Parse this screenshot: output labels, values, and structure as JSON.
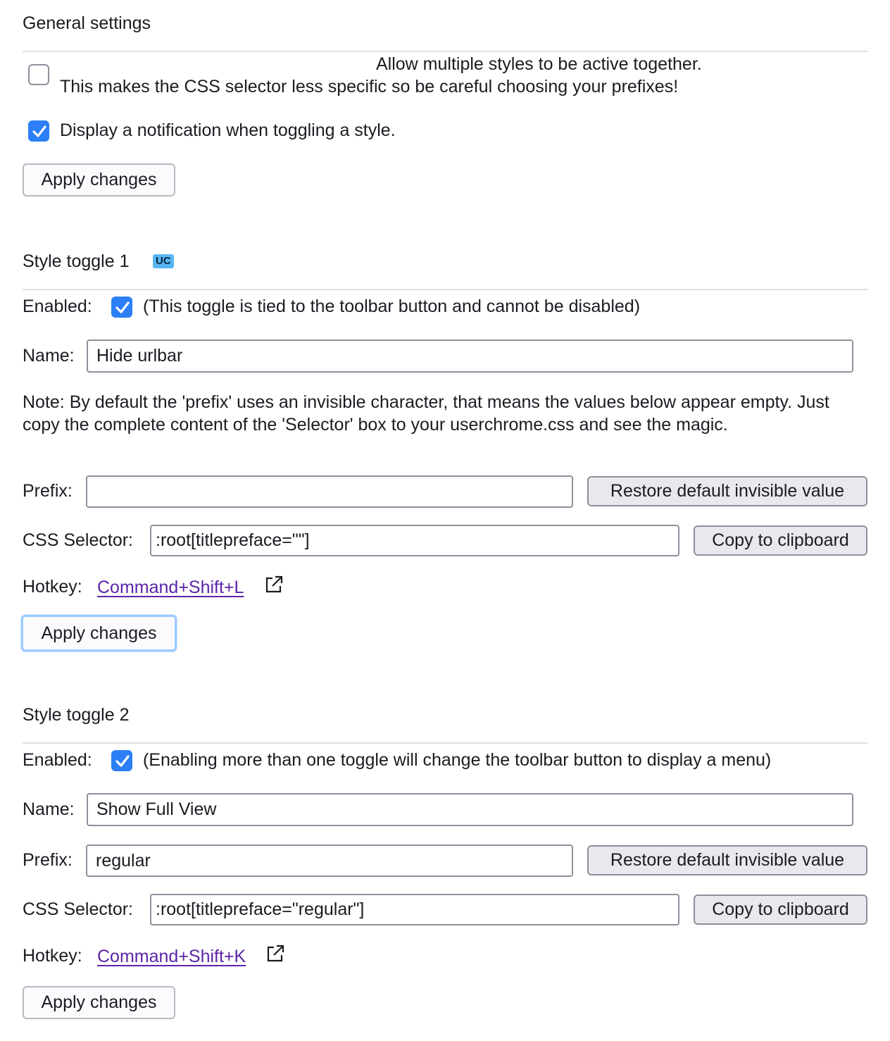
{
  "general": {
    "title": "General settings",
    "multi_styles_line1": "Allow multiple styles to be active together.",
    "multi_styles_line2": "This makes the CSS selector less specific so be careful choosing your prefixes!",
    "multi_styles_checked": false,
    "notification_label": "Display a notification when toggling a style.",
    "notification_checked": true,
    "apply_label": "Apply changes"
  },
  "toggles": [
    {
      "title": "Style toggle 1",
      "badge": "UC",
      "enabled_label": "Enabled:",
      "enabled_checked": true,
      "enabled_note": "(This toggle is tied to the toolbar button and cannot be disabled)",
      "name_label": "Name:",
      "name_value": "Hide urlbar",
      "note": "Note: By default the 'prefix' uses an invisible character, that means the values below appear empty. Just copy the complete content of the 'Selector' box to your userchrome.css and see the magic.",
      "prefix_label": "Prefix:",
      "prefix_value": "",
      "restore_label": "Restore default invisible value",
      "selector_label": "CSS Selector:",
      "selector_value": ":root[titlepreface=\"\"]",
      "copy_label": "Copy to clipboard",
      "hotkey_label": "Hotkey:",
      "hotkey_value": "Command+Shift+L",
      "apply_label": "Apply changes"
    },
    {
      "title": "Style toggle 2",
      "enabled_label": "Enabled:",
      "enabled_checked": true,
      "enabled_note": "(Enabling more than one toggle will change the toolbar button to display a menu)",
      "name_label": "Name:",
      "name_value": "Show Full View",
      "prefix_label": "Prefix:",
      "prefix_value": "regular",
      "restore_label": "Restore default invisible value",
      "selector_label": "CSS Selector:",
      "selector_value": ":root[titlepreface=\"regular\"]",
      "copy_label": "Copy to clipboard",
      "hotkey_label": "Hotkey:",
      "hotkey_value": "Command+Shift+K",
      "apply_label": "Apply changes"
    }
  ],
  "colors": {
    "accent": "#2c7ff6",
    "link": "#5a24a8",
    "badge_bg": "#58b6f2"
  }
}
